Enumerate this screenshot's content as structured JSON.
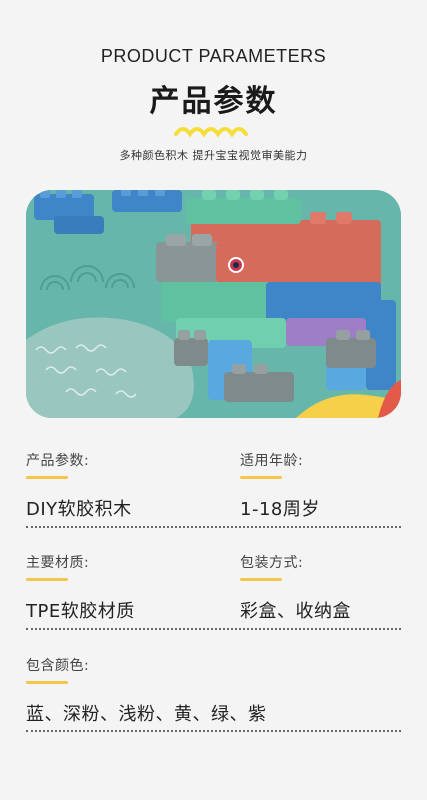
{
  "header": {
    "english_title": "PRODUCT PARAMETERS",
    "title": "产品参数",
    "subtitle": "多种颜色积木  提升宝宝视觉审美能力"
  },
  "colors": {
    "accent": "#f5c64a",
    "photo_bg": "#67b6ab"
  },
  "params": [
    {
      "label": "产品参数:",
      "value": "DIY软胶积木"
    },
    {
      "label": "适用年龄:",
      "value": "1-18周岁"
    },
    {
      "label": "主要材质:",
      "value": "TPE软胶材质"
    },
    {
      "label": "包装方式:",
      "value": "彩盒、收纳盒"
    },
    {
      "label": "包含颜色:",
      "value": "蓝、深粉、浅粉、黄、绿、紫"
    }
  ]
}
